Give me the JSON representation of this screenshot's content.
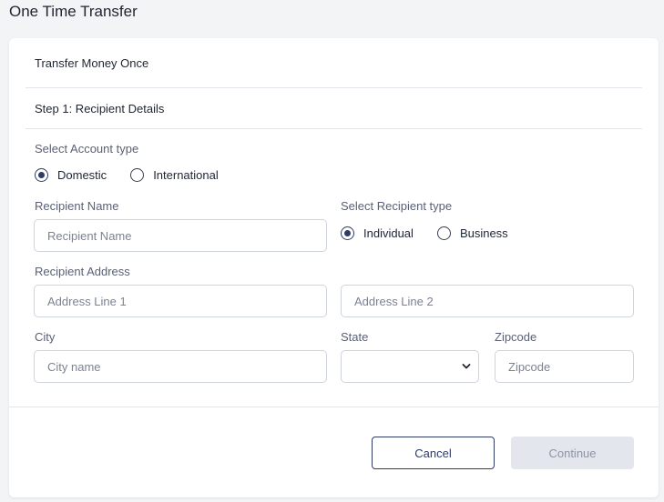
{
  "page": {
    "title": "One Time Transfer"
  },
  "card": {
    "header": "Transfer Money Once",
    "step_title": "Step 1: Recipient Details"
  },
  "account_type": {
    "label": "Select Account type",
    "options": [
      {
        "label": "Domestic",
        "checked": true
      },
      {
        "label": "International",
        "checked": false
      }
    ]
  },
  "recipient_name": {
    "label": "Recipient Name",
    "placeholder": "Recipient Name",
    "value": ""
  },
  "recipient_type": {
    "label": "Select Recipient type",
    "options": [
      {
        "label": "Individual",
        "checked": true
      },
      {
        "label": "Business",
        "checked": false
      }
    ]
  },
  "recipient_address": {
    "label": "Recipient Address",
    "line1_placeholder": "Address Line 1",
    "line2_placeholder": "Address Line 2"
  },
  "city": {
    "label": "City",
    "placeholder": "City name"
  },
  "state": {
    "label": "State",
    "selected": ""
  },
  "zipcode": {
    "label": "Zipcode",
    "placeholder": "Zipcode"
  },
  "actions": {
    "cancel_label": "Cancel",
    "continue_label": "Continue"
  },
  "colors": {
    "accent": "#2f3a66",
    "disabled_bg": "#e3e6ec",
    "page_bg": "#f3f4f6"
  }
}
